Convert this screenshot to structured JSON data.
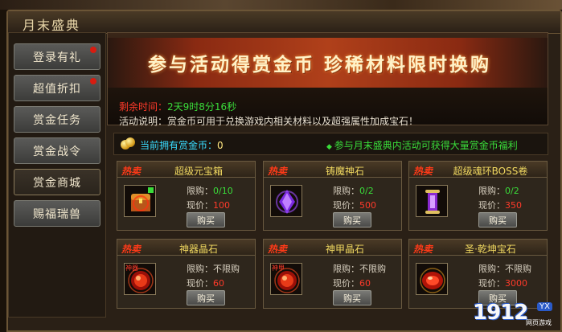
{
  "window": {
    "title": "月末盛典"
  },
  "sidebar": {
    "items": [
      {
        "label": "登录有礼",
        "notify": true
      },
      {
        "label": "超值折扣",
        "notify": true
      },
      {
        "label": "赏金任务",
        "notify": false
      },
      {
        "label": "赏金战令",
        "notify": false
      },
      {
        "label": "赏金商城",
        "notify": false,
        "active": true
      },
      {
        "label": "赐福瑞兽",
        "notify": false
      }
    ]
  },
  "banner": {
    "headline": "参与活动得赏金币  珍稀材料限时换购"
  },
  "info": {
    "time_label": "剩余时间：",
    "time_value": "2天9时8分16秒",
    "desc_label": "活动说明：",
    "desc_value": "赏金币可用于兑换游戏内相关材料以及超强属性加成宝石！"
  },
  "currency": {
    "label": "当前拥有赏金币：",
    "amount": "0",
    "tip": "参与月末盛典内活动可获得大量赏金币福利"
  },
  "shop": {
    "hot_tag": "热卖",
    "limit_label": "限购：",
    "price_label": "现价：",
    "buy_label": "购买",
    "items": [
      {
        "name": "超级元宝箱",
        "limit": "0/10",
        "price": "100",
        "icon": "treasure-chest-icon"
      },
      {
        "name": "铸魔神石",
        "limit": "0/2",
        "price": "500",
        "icon": "purple-crystal-icon"
      },
      {
        "name": "超级魂环BOSS卷",
        "limit": "0/2",
        "price": "350",
        "icon": "scroll-icon"
      },
      {
        "name": "神器晶石",
        "limit": "不限购",
        "price": "60",
        "icon": "red-orb-icon",
        "bind": "神器"
      },
      {
        "name": "神甲晶石",
        "limit": "不限购",
        "price": "60",
        "icon": "red-orb-icon",
        "bind": "神甲"
      },
      {
        "name": "圣·乾坤宝石",
        "limit": "不限购",
        "price": "3000",
        "icon": "red-gem-icon"
      }
    ]
  },
  "watermark": {
    "number": "1912",
    "tag": "YX",
    "sub": "网页游戏"
  }
}
